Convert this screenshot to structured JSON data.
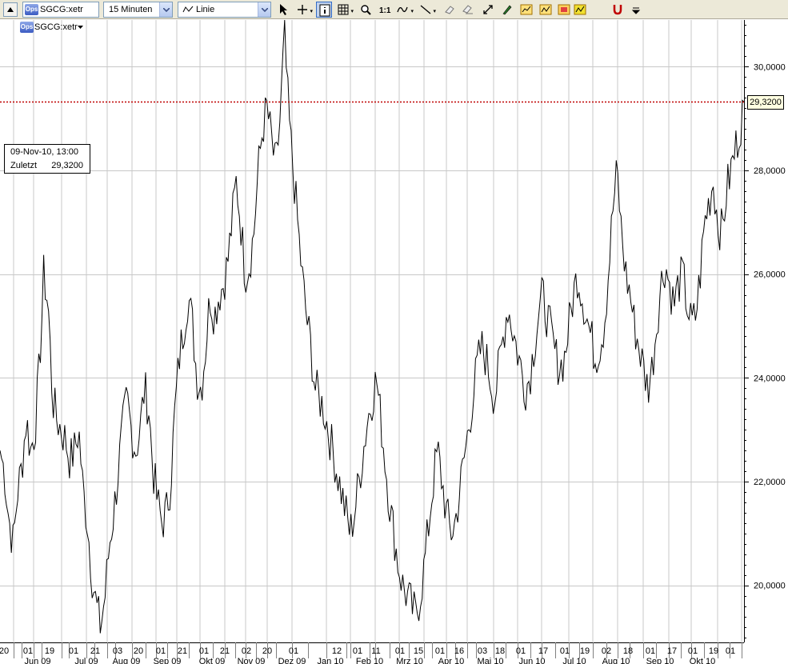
{
  "toolbar": {
    "symbol": "SGCG:xetr",
    "symbol_badge": "Ops",
    "interval": "15 Minuten",
    "style": "Linie",
    "tools": [
      {
        "name": "pointer-icon",
        "active": false
      },
      {
        "name": "crosshair-icon",
        "active": false
      },
      {
        "name": "info-icon",
        "active": true
      },
      {
        "name": "grid-icon",
        "active": false
      },
      {
        "name": "zoom-icon",
        "active": false
      },
      {
        "name": "scale-1to1-icon",
        "active": false
      },
      {
        "name": "indicator-icon",
        "active": false
      },
      {
        "name": "trendline-icon",
        "active": false
      },
      {
        "name": "eraser-icon",
        "active": false
      },
      {
        "name": "eraser-all-icon",
        "active": false
      },
      {
        "name": "arrows-icon",
        "active": false
      },
      {
        "name": "pen-icon",
        "active": false
      },
      {
        "name": "chart-window-icon",
        "active": false
      },
      {
        "name": "compare-chart-icon",
        "active": false
      },
      {
        "name": "multi-chart-icon",
        "active": false
      },
      {
        "name": "highlight-chart-icon",
        "active": false
      },
      {
        "name": "magnet-icon",
        "active": false
      },
      {
        "name": "overflow-icon",
        "active": false
      }
    ]
  },
  "tooltip": {
    "date": "09-Nov-10, 13:00",
    "label": "Zuletzt",
    "value": "29,3200"
  },
  "price_marker": {
    "value": "29,3200",
    "price": 29.32,
    "line_color": "#c00000"
  },
  "colors": {
    "grid": "#c8c8c8",
    "line": "#000000",
    "background": "#ffffff"
  },
  "chart_data": {
    "type": "line",
    "series": [
      {
        "values": [
          22.6,
          22.2,
          21.3,
          20.8,
          21.8,
          22.3,
          23.2,
          22.6,
          23.0,
          24.2,
          26.0,
          25.4,
          23.6,
          23.2,
          23.0,
          22.8,
          22.4,
          22.6,
          23.0,
          21.8,
          21.2,
          20.2,
          19.6,
          19.2,
          19.8,
          20.8,
          21.4,
          22.2,
          23.0,
          23.6,
          23.0,
          22.6,
          23.0,
          23.8,
          23.4,
          22.2,
          21.6,
          21.2,
          21.4,
          22.0,
          23.4,
          24.4,
          25.0,
          25.6,
          25.0,
          24.0,
          23.8,
          24.6,
          25.6,
          25.2,
          25.6,
          25.8,
          26.2,
          27.0,
          27.8,
          27.0,
          26.0,
          26.2,
          26.8,
          28.0,
          28.8,
          29.2,
          28.6,
          28.0,
          29.0,
          30.6,
          29.0,
          28.0,
          27.0,
          26.0,
          25.2,
          24.6,
          23.8,
          23.6,
          23.4,
          23.0,
          22.6,
          22.2,
          21.8,
          21.4,
          21.0,
          21.4,
          22.0,
          22.6,
          23.2,
          23.6,
          24.0,
          23.2,
          22.4,
          21.6,
          21.0,
          20.4,
          20.0,
          19.8,
          19.6,
          19.4,
          19.8,
          20.4,
          21.2,
          22.0,
          22.6,
          22.0,
          21.4,
          21.0,
          21.2,
          21.8,
          22.4,
          23.0,
          23.6,
          24.2,
          24.6,
          24.4,
          24.0,
          23.6,
          24.2,
          24.8,
          25.4,
          25.0,
          24.6,
          24.2,
          23.8,
          24.0,
          24.6,
          25.2,
          25.6,
          25.2,
          24.8,
          24.4,
          24.2,
          24.4,
          25.0,
          25.6,
          26.0,
          25.6,
          25.2,
          24.8,
          24.4,
          24.6,
          25.0,
          26.0,
          27.2,
          28.0,
          26.8,
          26.0,
          25.6,
          25.0,
          24.6,
          24.2,
          23.8,
          24.2,
          25.0,
          25.8,
          26.2,
          25.8,
          25.4,
          25.8,
          26.0,
          25.4,
          25.0,
          25.2,
          26.0,
          27.0,
          27.4,
          27.8,
          27.0,
          26.8,
          27.6,
          28.0,
          28.4,
          28.8,
          29.32
        ],
        "x_range": [
          0,
          930
        ]
      }
    ],
    "ylim": [
      18.9,
      30.9
    ],
    "yticks": [
      {
        "value": 20,
        "label": "20,0000"
      },
      {
        "value": 22,
        "label": "22,0000"
      },
      {
        "value": 24,
        "label": "24,0000"
      },
      {
        "value": 26,
        "label": "26,0000"
      },
      {
        "value": 28,
        "label": "28,0000"
      },
      {
        "value": 30,
        "label": "30,0000"
      }
    ],
    "xticks": [
      "20",
      "01",
      "19",
      "01",
      "21",
      "03",
      "20",
      "01",
      "21",
      "01",
      "21",
      "02",
      "20",
      "01",
      "12",
      "01",
      "11",
      "01",
      "15",
      "01",
      "16",
      "03",
      "18",
      "01",
      "17",
      "01",
      "19",
      "02",
      "18",
      "01",
      "17",
      "01",
      "19",
      "01"
    ],
    "xticks_gridpos": [
      17,
      42,
      77,
      108,
      134,
      165,
      195,
      221,
      250,
      281,
      307,
      334,
      365,
      408,
      438,
      469,
      499,
      530,
      558,
      584,
      617,
      647,
      677,
      711,
      741,
      772,
      804,
      836,
      864,
      897,
      927
    ],
    "months": [
      "Jun 09",
      "Jul 09",
      "Aug 09",
      "Sep 09",
      "Okt 09",
      "Nov 09",
      "Dez 09",
      "Jan 10",
      "Feb 10",
      "Mrz 10",
      "Apr 10",
      "Mai 10",
      "Jun 10",
      "Jul 10",
      "Aug 10",
      "Sep 10",
      "Okt 10"
    ],
    "grid": true
  }
}
